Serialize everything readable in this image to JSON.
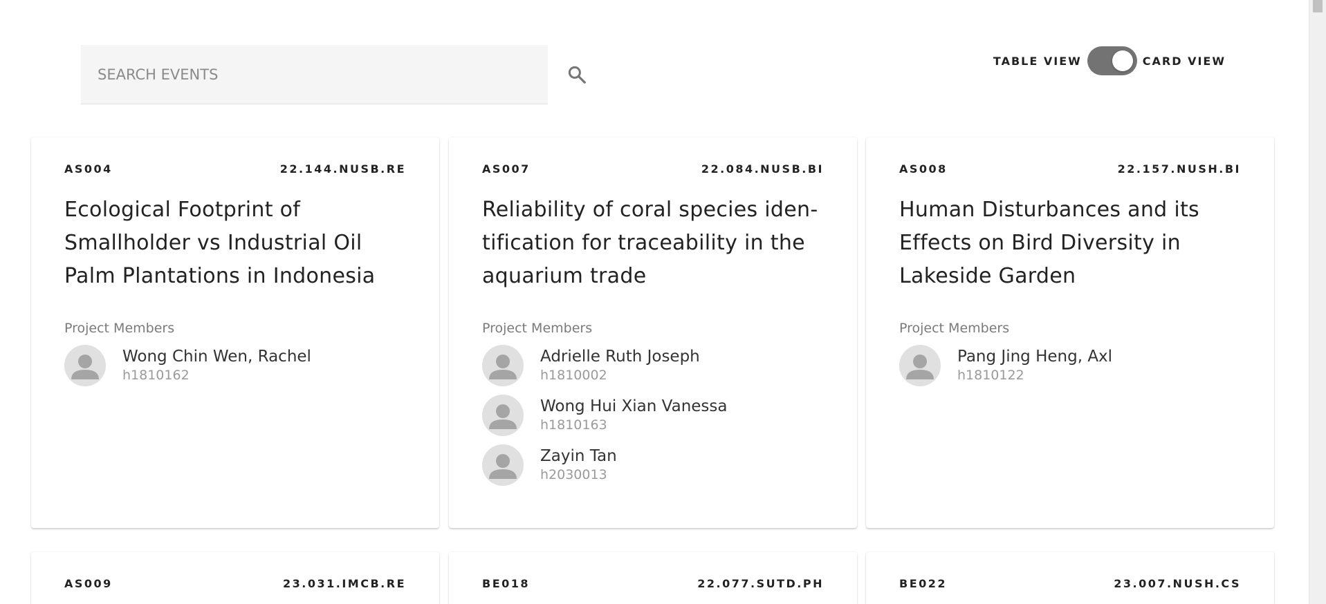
{
  "search": {
    "placeholder": "SEARCH EVENTS",
    "value": ""
  },
  "view_toggle": {
    "left_label": "TABLE VIEW",
    "right_label": "CARD VIEW",
    "selected": "CARD VIEW"
  },
  "cards": [
    {
      "code": "AS004",
      "ref": "22.144.NUSB.RE",
      "title": "Ecological Footprint of Smallholder vs Industrial Oil Palm Plantations in Indonesia",
      "members_label": "Project Members",
      "members": [
        {
          "name": "Wong Chin Wen, Rachel",
          "id": "h1810162"
        }
      ]
    },
    {
      "code": "AS007",
      "ref": "22.084.NUSB.BI",
      "title": "Reliability of coral species iden-tification for traceability in the aquarium trade",
      "members_label": "Project Members",
      "members": [
        {
          "name": "Adrielle Ruth Joseph",
          "id": "h1810002"
        },
        {
          "name": "Wong Hui Xian Vanessa",
          "id": "h1810163"
        },
        {
          "name": "Zayin Tan",
          "id": "h2030013"
        }
      ]
    },
    {
      "code": "AS008",
      "ref": "22.157.NUSH.BI",
      "title": "Human Disturbances and its Effects on Bird Diversity in Lakeside Garden",
      "members_label": "Project Members",
      "members": [
        {
          "name": "Pang Jing Heng, Axl",
          "id": "h1810122"
        }
      ]
    },
    {
      "code": "AS009",
      "ref": "23.031.IMCB.RE"
    },
    {
      "code": "BE018",
      "ref": "22.077.SUTD.PH"
    },
    {
      "code": "BE022",
      "ref": "23.007.NUSH.CS"
    }
  ]
}
